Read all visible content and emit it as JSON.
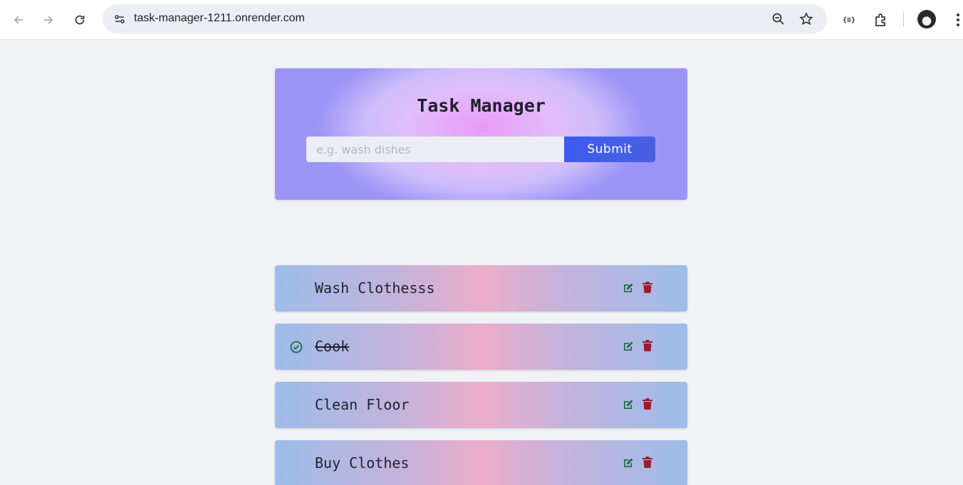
{
  "browser": {
    "url": "task-manager-1211.onrender.com",
    "icons": [
      "back-icon",
      "forward-icon",
      "reload-icon",
      "site-info-icon",
      "zoom-icon",
      "bookmark-star-icon",
      "extension-icon",
      "puzzle-icon",
      "profile-avatar",
      "menu-icon"
    ],
    "extension_label": "{≡}"
  },
  "app": {
    "title": "Task Manager",
    "input_placeholder": "e.g. wash dishes",
    "input_value": "",
    "submit_label": "Submit"
  },
  "tasks": [
    {
      "name": "Wash Clothesss",
      "completed": false
    },
    {
      "name": "Cook",
      "completed": true
    },
    {
      "name": "Clean Floor",
      "completed": false
    },
    {
      "name": "Buy Clothes",
      "completed": false
    }
  ],
  "colors": {
    "edit_icon": "#1e6b48",
    "delete_icon": "#9b1c2c",
    "check_icon": "#1e6b48",
    "submit_bg": "#3d5bf0"
  }
}
